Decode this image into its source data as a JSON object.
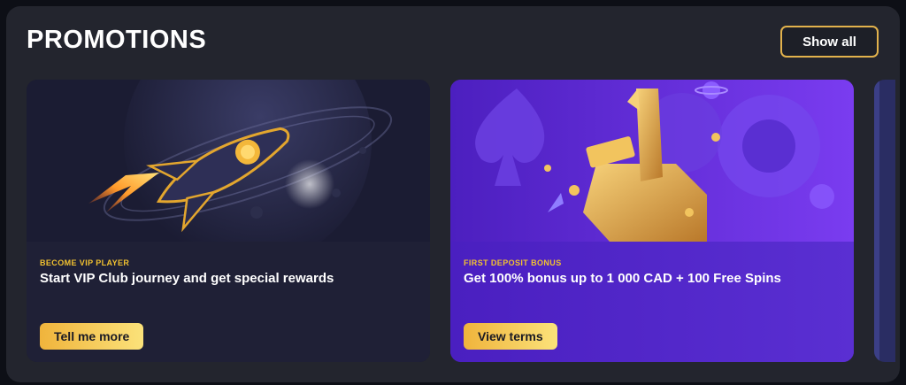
{
  "header": {
    "title": "PROMOTIONS",
    "show_all_label": "Show all"
  },
  "colors": {
    "panel": "#23252e",
    "accent_gold": "#f2c230",
    "vip_card": "#1f2036",
    "deposit_card": "#4b22c5"
  },
  "promotions": [
    {
      "kicker": "BECOME VIP PLAYER",
      "headline": "Start VIP Club journey and get special rewards",
      "cta_label": "Tell me more",
      "icon": "rocket-illustration"
    },
    {
      "kicker": "FIRST DEPOSIT BONUS",
      "headline": "Get 100% bonus up to 1 000 CAD + 100 Free Spins",
      "cta_label": "View terms",
      "icon": "number-one-trophy-illustration"
    }
  ]
}
